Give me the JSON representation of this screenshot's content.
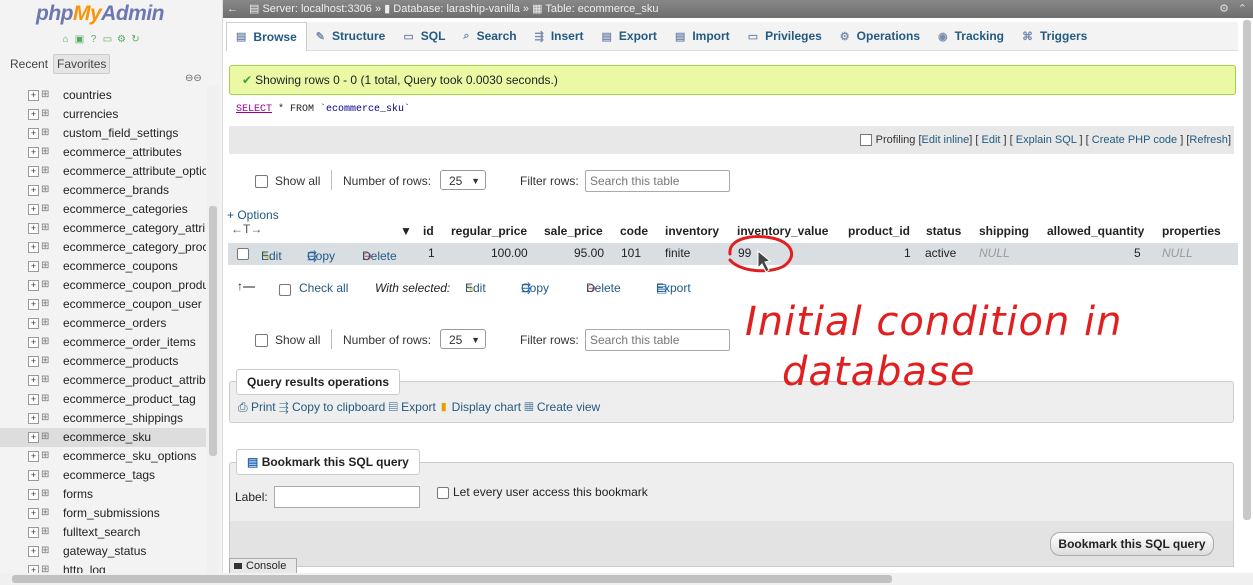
{
  "nav": {
    "logo_php": "php",
    "logo_my": "My",
    "logo_admin": "Admin",
    "tab_recent": "Recent",
    "tab_favorites": "Favorites",
    "tables": [
      "countries",
      "currencies",
      "custom_field_settings",
      "ecommerce_attributes",
      "ecommerce_attribute_optic",
      "ecommerce_brands",
      "ecommerce_categories",
      "ecommerce_category_attri",
      "ecommerce_category_proc",
      "ecommerce_coupons",
      "ecommerce_coupon_produ",
      "ecommerce_coupon_user",
      "ecommerce_orders",
      "ecommerce_order_items",
      "ecommerce_products",
      "ecommerce_product_attrib",
      "ecommerce_product_tag",
      "ecommerce_shippings",
      "ecommerce_sku",
      "ecommerce_sku_options",
      "ecommerce_tags",
      "forms",
      "form_submissions",
      "fulltext_search",
      "gateway_status",
      "http_log"
    ],
    "selected_table": "ecommerce_sku"
  },
  "breadcrumb": {
    "server": "Server: localhost:3306",
    "database": "Database: laraship-vanilla",
    "table": "Table: ecommerce_sku"
  },
  "tabs": [
    "Browse",
    "Structure",
    "SQL",
    "Search",
    "Insert",
    "Export",
    "Import",
    "Privileges",
    "Operations",
    "Tracking",
    "Triggers"
  ],
  "success_message": "Showing rows 0 - 0 (1 total, Query took 0.0030 seconds.)",
  "sql": {
    "keyword": "SELECT",
    "rest": " * FROM ",
    "table": "`ecommerce_sku`"
  },
  "profiling": {
    "label": "Profiling",
    "edit_inline": "Edit inline",
    "edit": "Edit",
    "explain": "Explain SQL",
    "php": "Create PHP code",
    "refresh": "Refresh"
  },
  "row_controls": {
    "show_all": "Show all",
    "number_of_rows": "Number of rows:",
    "rows_value": "25",
    "filter_rows": "Filter rows:",
    "filter_placeholder": "Search this table"
  },
  "options_link": "+ Options",
  "table": {
    "columns": [
      "id",
      "regular_price",
      "sale_price",
      "code",
      "inventory",
      "inventory_value",
      "product_id",
      "status",
      "shipping",
      "allowed_quantity",
      "properties"
    ],
    "row": {
      "edit": "Edit",
      "copy": "Copy",
      "delete": "Delete",
      "id": "1",
      "regular_price": "100.00",
      "sale_price": "95.00",
      "code": "101",
      "inventory": "finite",
      "inventory_value": "99",
      "product_id": "1",
      "status": "active",
      "shipping": "NULL",
      "allowed_quantity": "5",
      "properties": "NULL"
    }
  },
  "with_selected": {
    "check_all": "Check all",
    "label": "With selected:",
    "edit": "Edit",
    "copy": "Copy",
    "delete": "Delete",
    "export": "Export"
  },
  "query_results": {
    "legend": "Query results operations",
    "print": "Print",
    "copy": "Copy to clipboard",
    "export": "Export",
    "chart": "Display chart",
    "view": "Create view"
  },
  "bookmark": {
    "legend": "Bookmark this SQL query",
    "label": "Label:",
    "access": "Let every user access this bookmark",
    "button": "Bookmark this SQL query"
  },
  "console": "Console",
  "annotation": {
    "line1": "Initial condition in",
    "line2": "database",
    "color": "#e02020"
  }
}
